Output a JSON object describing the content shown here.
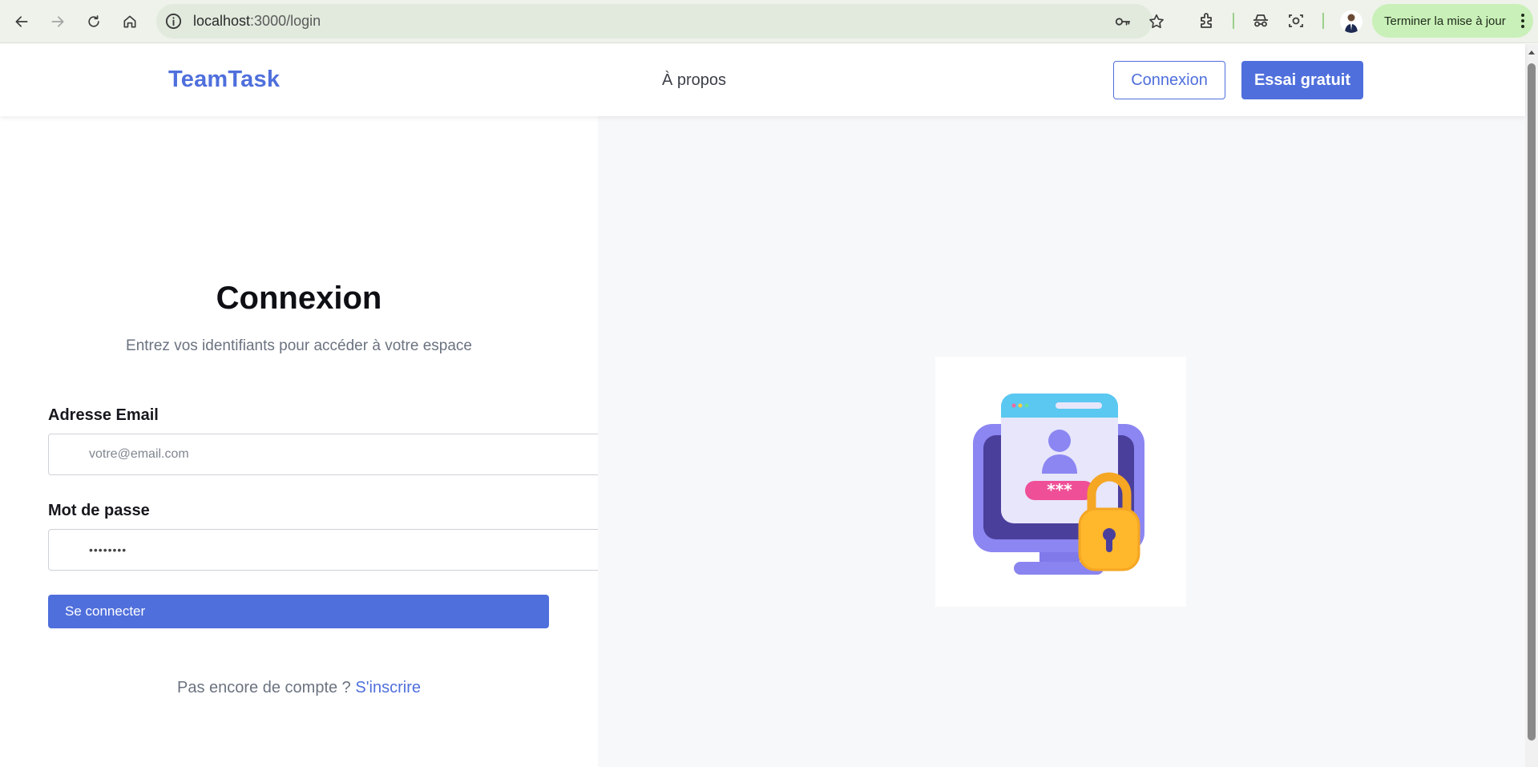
{
  "browser": {
    "url_host": "localhost",
    "url_path": ":3000/login",
    "update_button": "Terminer la mise à jour"
  },
  "header": {
    "logo": "TeamTask",
    "nav_about": "À propos",
    "login_button": "Connexion",
    "trial_button": "Essai gratuit"
  },
  "login": {
    "title": "Connexion",
    "subtitle": "Entrez vos identifiants pour accéder à votre espace",
    "email_label": "Adresse Email",
    "email_placeholder": "votre@email.com",
    "password_label": "Mot de passe",
    "password_value": "••••••••",
    "submit_button": "Se connecter",
    "signup_prompt": "Pas encore de compte ?",
    "signup_link": "S'inscrire"
  },
  "illustration": {
    "password_mask": "***"
  },
  "colors": {
    "accent": "#4f6fdc",
    "right_panel_bg": "#f7f8fa",
    "update_button_bg": "#c9f0b8"
  }
}
